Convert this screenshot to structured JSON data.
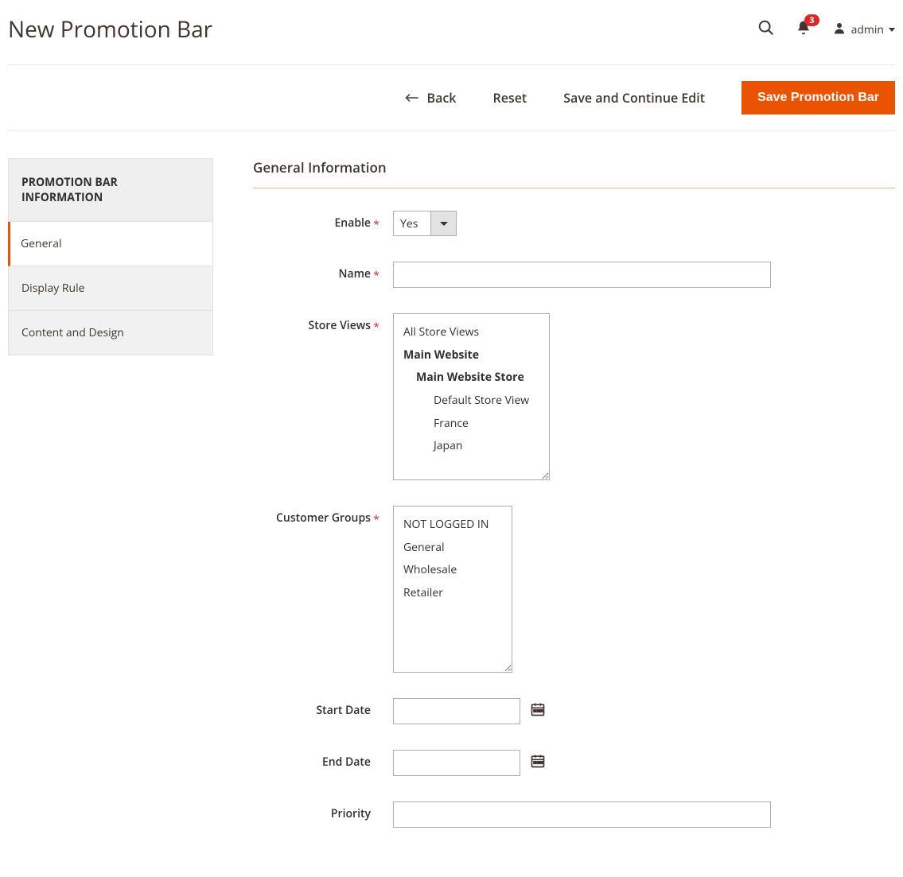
{
  "header": {
    "title": "New Promotion Bar",
    "notification_count": "3",
    "user_name": "admin"
  },
  "actions": {
    "back": "Back",
    "reset": "Reset",
    "save_continue": "Save and Continue Edit",
    "save": "Save Promotion Bar"
  },
  "sidebar": {
    "heading": "PROMOTION BAR INFORMATION",
    "items": [
      "General",
      "Display Rule",
      "Content and Design"
    ]
  },
  "section_title": "General Information",
  "fields": {
    "enable": {
      "label": "Enable",
      "value": "Yes"
    },
    "name": {
      "label": "Name",
      "value": ""
    },
    "store_views": {
      "label": "Store Views",
      "options": {
        "all": "All Store Views",
        "website": "Main Website",
        "store": "Main Website Store",
        "views": [
          "Default Store View",
          "France",
          "Japan"
        ]
      }
    },
    "customer_groups": {
      "label": "Customer Groups",
      "options": [
        "NOT LOGGED IN",
        "General",
        "Wholesale",
        "Retailer"
      ]
    },
    "start_date": {
      "label": "Start Date",
      "value": ""
    },
    "end_date": {
      "label": "End Date",
      "value": ""
    },
    "priority": {
      "label": "Priority",
      "value": ""
    }
  }
}
